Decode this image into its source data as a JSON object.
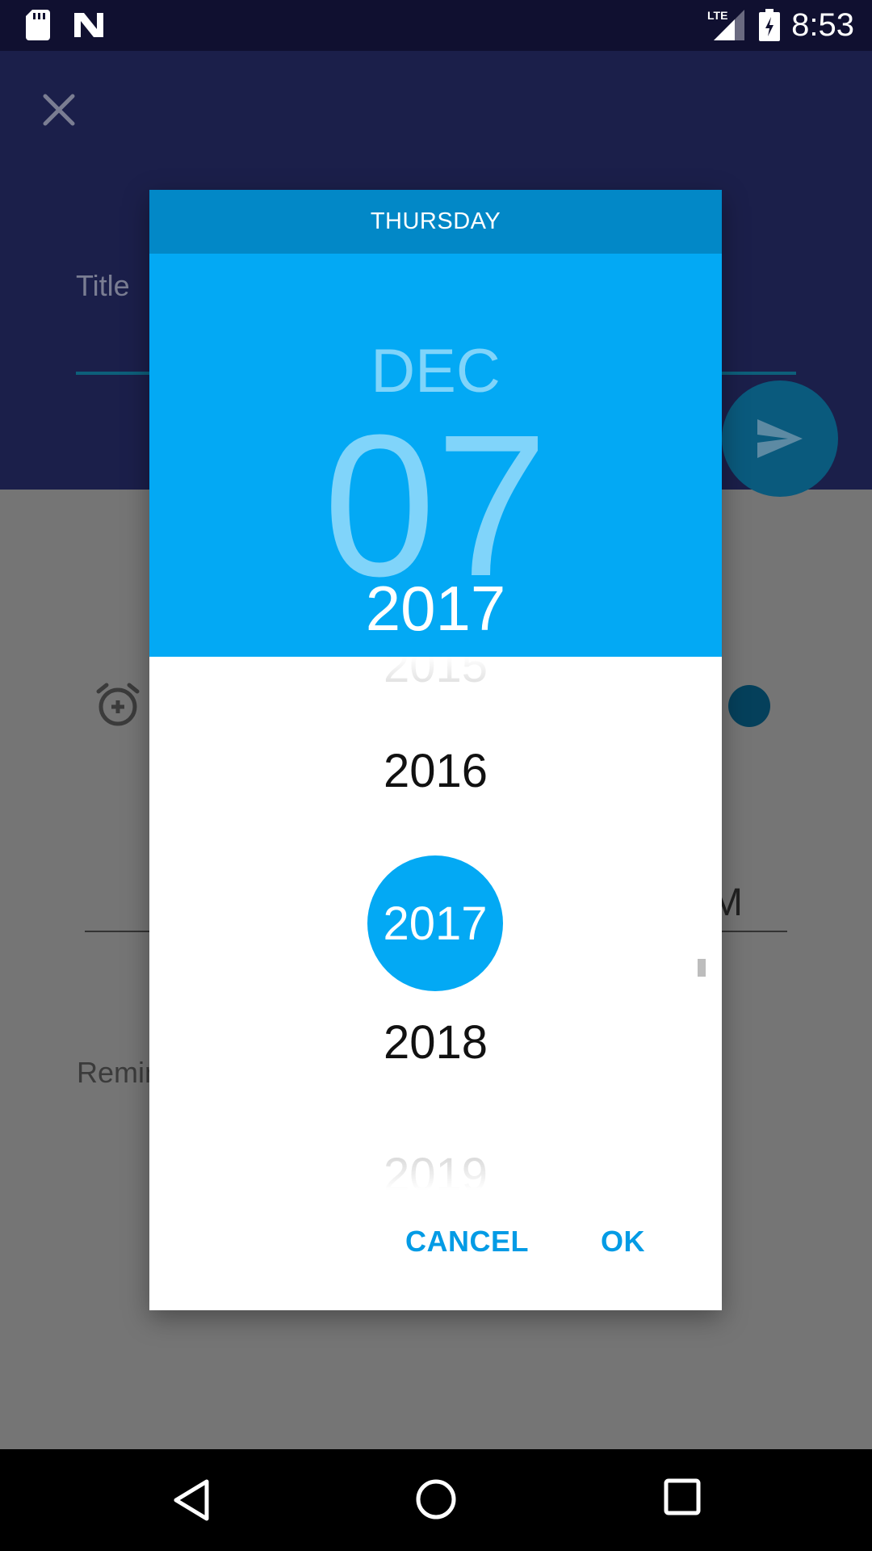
{
  "status_bar": {
    "network": "LTE",
    "time": "8:53",
    "icons": [
      "sd-card-icon",
      "n-notification-icon",
      "lte-signal-icon",
      "battery-charging-icon"
    ]
  },
  "background": {
    "title_placeholder": "Title",
    "time_fragment": "M",
    "remind_label": "Remin",
    "icons": [
      "close-icon",
      "send-icon",
      "alarm-add-icon"
    ]
  },
  "dialog": {
    "day_of_week": "THURSDAY",
    "month": "DEC",
    "day": "07",
    "year": "2017",
    "years": {
      "prev2": "2015",
      "prev1": "2016",
      "selected": "2017",
      "next1": "2018",
      "next2": "2019"
    },
    "cancel_label": "CANCEL",
    "ok_label": "OK",
    "accent_color": "#03a9f4"
  },
  "nav_bar": {
    "icons": [
      "back-icon",
      "home-icon",
      "recents-icon"
    ]
  }
}
